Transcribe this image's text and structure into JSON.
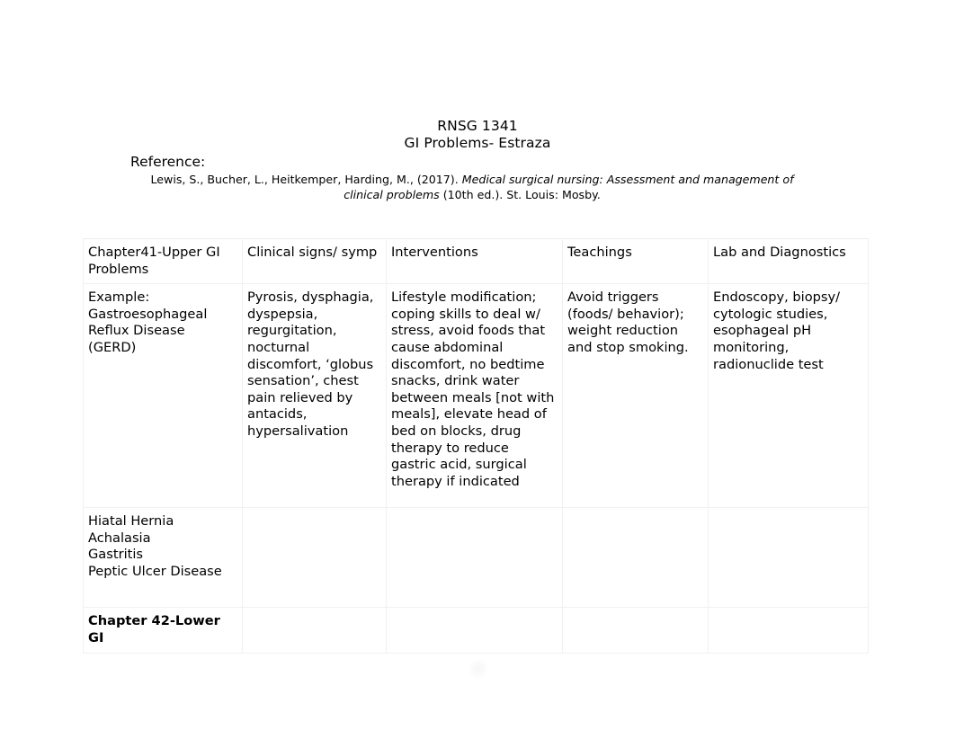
{
  "document": {
    "title_line_1": "RNSG 1341",
    "title_line_2": "GI Problems- Estraza"
  },
  "reference": {
    "label": "Reference:",
    "authors_and_year": "Lewis, S., Bucher, L., Heitkemper, Harding, M., (2017). ",
    "book_title_italic": "Medical surgical nursing: Assessment and management of clinical problems",
    "edition_and_publisher": " (10th ed.). St. Louis: Mosby."
  },
  "table": {
    "headers": [
      "Chapter41-Upper GI Problems",
      "Clinical signs/ symp",
      "Interventions",
      "Teachings",
      "Lab and Diagnostics"
    ],
    "rows": [
      {
        "condition": "Example: Gastroesophageal Reflux Disease (GERD)",
        "clinical_signs": "Pyrosis, dysphagia, dyspepsia, regurgitation, nocturnal discomfort, ‘globus sensation’, chest pain relieved by antacids, hypersalivation",
        "interventions": "Lifestyle modification; coping skills to deal w/ stress, avoid foods that cause abdominal discomfort, no bedtime  snacks, drink water between meals [not with meals], elevate head of bed on blocks, drug therapy to reduce gastric acid, surgical therapy if indicated",
        "teachings": "Avoid triggers (foods/ behavior); weight reduction and stop smoking.",
        "lab_and_diagnostics": "Endoscopy, biopsy/ cytologic studies, esophageal pH monitoring, radionuclide test"
      },
      {
        "condition": "Hiatal Hernia\nAchalasia\nGastritis\nPeptic Ulcer Disease",
        "clinical_signs": "",
        "interventions": "",
        "teachings": "",
        "lab_and_diagnostics": ""
      },
      {
        "condition": "Chapter 42-Lower GI",
        "clinical_signs": "",
        "interventions": "",
        "teachings": "",
        "lab_and_diagnostics": ""
      }
    ]
  }
}
